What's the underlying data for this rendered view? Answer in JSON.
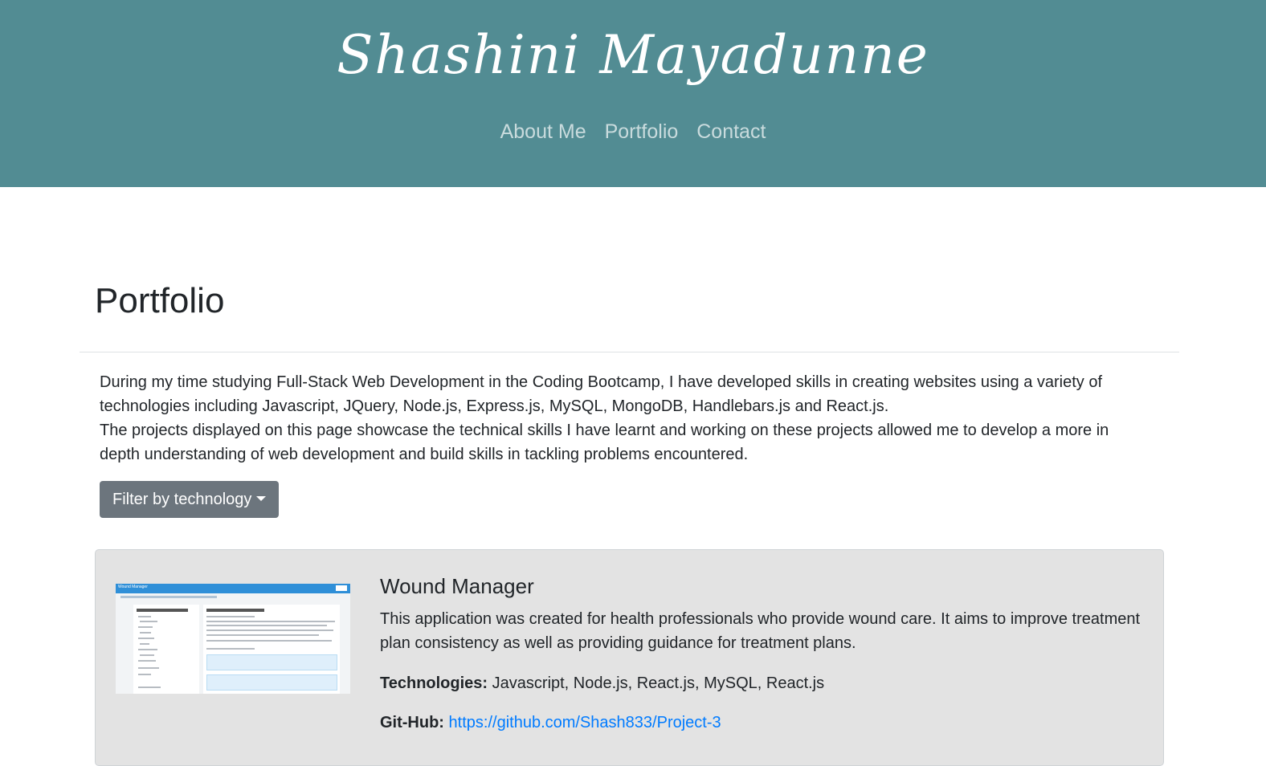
{
  "header": {
    "brand": "Shashini Mayadunne",
    "nav": [
      "About Me",
      "Portfolio",
      "Contact"
    ]
  },
  "page": {
    "title": "Portfolio",
    "intro": [
      "During my time studying Full-Stack Web Development in the Coding Bootcamp, I have developed skills in creating websites using a variety of technologies including Javascript, JQuery, Node.js, Express.js, MySQL, MongoDB, Handlebars.js and React.js.",
      "The projects displayed on this page showcase the technical skills I have learnt and working on these projects allowed me to develop a more in depth understanding of web development and build skills in tackling problems encountered."
    ],
    "filter_label": "Filter by technology"
  },
  "projects": [
    {
      "title": "Wound Manager",
      "description": "This application was created for health professionals who provide wound care. It aims to improve treatment plan consistency as well as providing guidance for treatment plans.",
      "technologies_label": "Technologies:",
      "technologies": "Javascript, Node.js, React.js, MySQL, React.js",
      "github_label": "Git-Hub:",
      "github_url": "https://github.com/Shash833/Project-3",
      "screenshot": {
        "app_title": "Wound Manager",
        "left_heading": "Objective Wound assessment:",
        "right_heading": "Wound Care Recommendations"
      }
    }
  ],
  "colors": {
    "header_bg": "#528c93",
    "nav_link": "#c9dbdd",
    "button_bg": "#6c757d",
    "card_bg": "#e3e3e3",
    "link": "#007bff"
  }
}
